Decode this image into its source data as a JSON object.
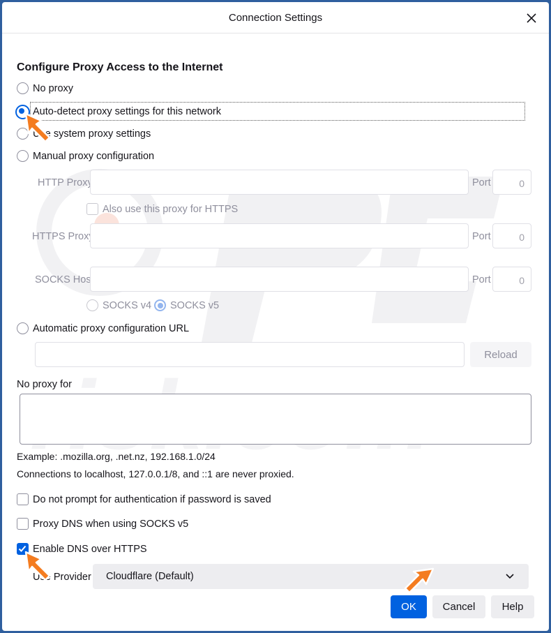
{
  "window": {
    "title": "Connection Settings"
  },
  "section": {
    "heading": "Configure Proxy Access to the Internet"
  },
  "proxy_options": {
    "no_proxy": "No proxy",
    "auto_detect": "Auto-detect proxy settings for this network",
    "use_system": "Use system proxy settings",
    "manual": "Manual proxy configuration",
    "auto_url": "Automatic proxy configuration URL",
    "selected": "auto_detect"
  },
  "manual": {
    "http_proxy_label": "HTTP Proxy",
    "https_proxy_label": "HTTPS Proxy",
    "socks_host_label": "SOCKS Host",
    "port_label": "Port",
    "http_port": "0",
    "https_port": "0",
    "socks_port": "0",
    "also_use_https": "Also use this proxy for HTTPS",
    "socks_v4": "SOCKS v4",
    "socks_v5": "SOCKS v5",
    "socks_selected": "v5"
  },
  "auto_url": {
    "reload_label": "Reload",
    "value": ""
  },
  "no_proxy_for": {
    "label": "No proxy for",
    "value": "",
    "example": "Example: .mozilla.org, .net.nz, 192.168.1.0/24",
    "note": "Connections to localhost, 127.0.0.1/8, and ::1 are never proxied."
  },
  "options": {
    "no_prompt_auth": "Do not prompt for authentication if password is saved",
    "proxy_dns": "Proxy DNS when using SOCKS v5",
    "enable_doh": "Enable DNS over HTTPS",
    "no_prompt_auth_checked": false,
    "proxy_dns_checked": false,
    "enable_doh_checked": true
  },
  "provider": {
    "label": "Use Provider",
    "selected": "Cloudflare (Default)"
  },
  "buttons": {
    "ok": "OK",
    "cancel": "Cancel",
    "help": "Help"
  },
  "colors": {
    "accent": "#0061e0",
    "frame": "#2f5f9e",
    "annotation_arrow": "#f47c20"
  },
  "icons": {
    "close": "close-icon",
    "chevron": "chevron-down-icon",
    "check": "check-icon",
    "arrow": "pointer-arrow-icon"
  }
}
